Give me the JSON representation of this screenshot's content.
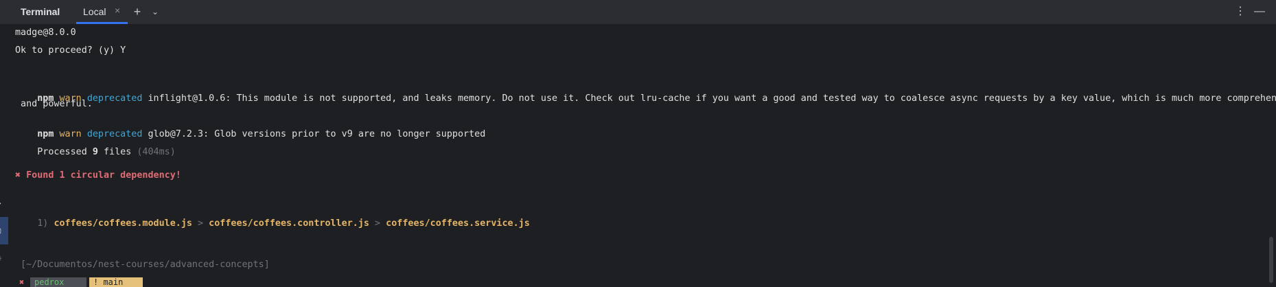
{
  "tabbar": {
    "title": "Terminal",
    "tab_label": "Local",
    "close_glyph": "×",
    "new_tab_glyph": "+",
    "dropdown_glyph": "⌄",
    "more_glyph": "⋮",
    "minimize_glyph": "—"
  },
  "terminal": {
    "line1": "madge@8.0.0",
    "line2": "Ok to proceed? (y) Y",
    "warn1": {
      "npm": "npm",
      "warn": "warn",
      "deprecated": "deprecated",
      "text": "inflight@1.0.6: This module is not supported, and leaks memory. Do not use it. Check out lru-cache if you want a good and tested way to coalesce async requests by a key value, which is much more comprehensive",
      "text_cont": " and powerful."
    },
    "warn2": {
      "npm": "npm",
      "warn": "warn",
      "deprecated": "deprecated",
      "text": "glob@7.2.3: Glob versions prior to v9 are no longer supported"
    },
    "processed": {
      "prefix": "Processed",
      "count": "9",
      "suffix": "files",
      "time": "(404ms)"
    },
    "error": "✖ Found 1 circular dependency!",
    "cycle": {
      "index": "1)",
      "paths": [
        "coffees/coffees.module.js",
        "coffees/coffees.controller.js",
        "coffees/coffees.service.js"
      ],
      "separator": ">"
    },
    "cwd": "[~/Documentos/nest-courses/advanced-concepts]",
    "prompt": {
      "status": "✖",
      "user": "pedrox",
      "branch": "! main"
    }
  },
  "colors": {
    "background": "#1e1f22",
    "warn": "#e5b567",
    "deprecated": "#3fa7d6",
    "error": "#e06c75",
    "accent": "#3574f0"
  },
  "icons": {
    "gutter1": "git-icon",
    "gutter2": "terminal-icon",
    "gutter3": "history-icon"
  }
}
